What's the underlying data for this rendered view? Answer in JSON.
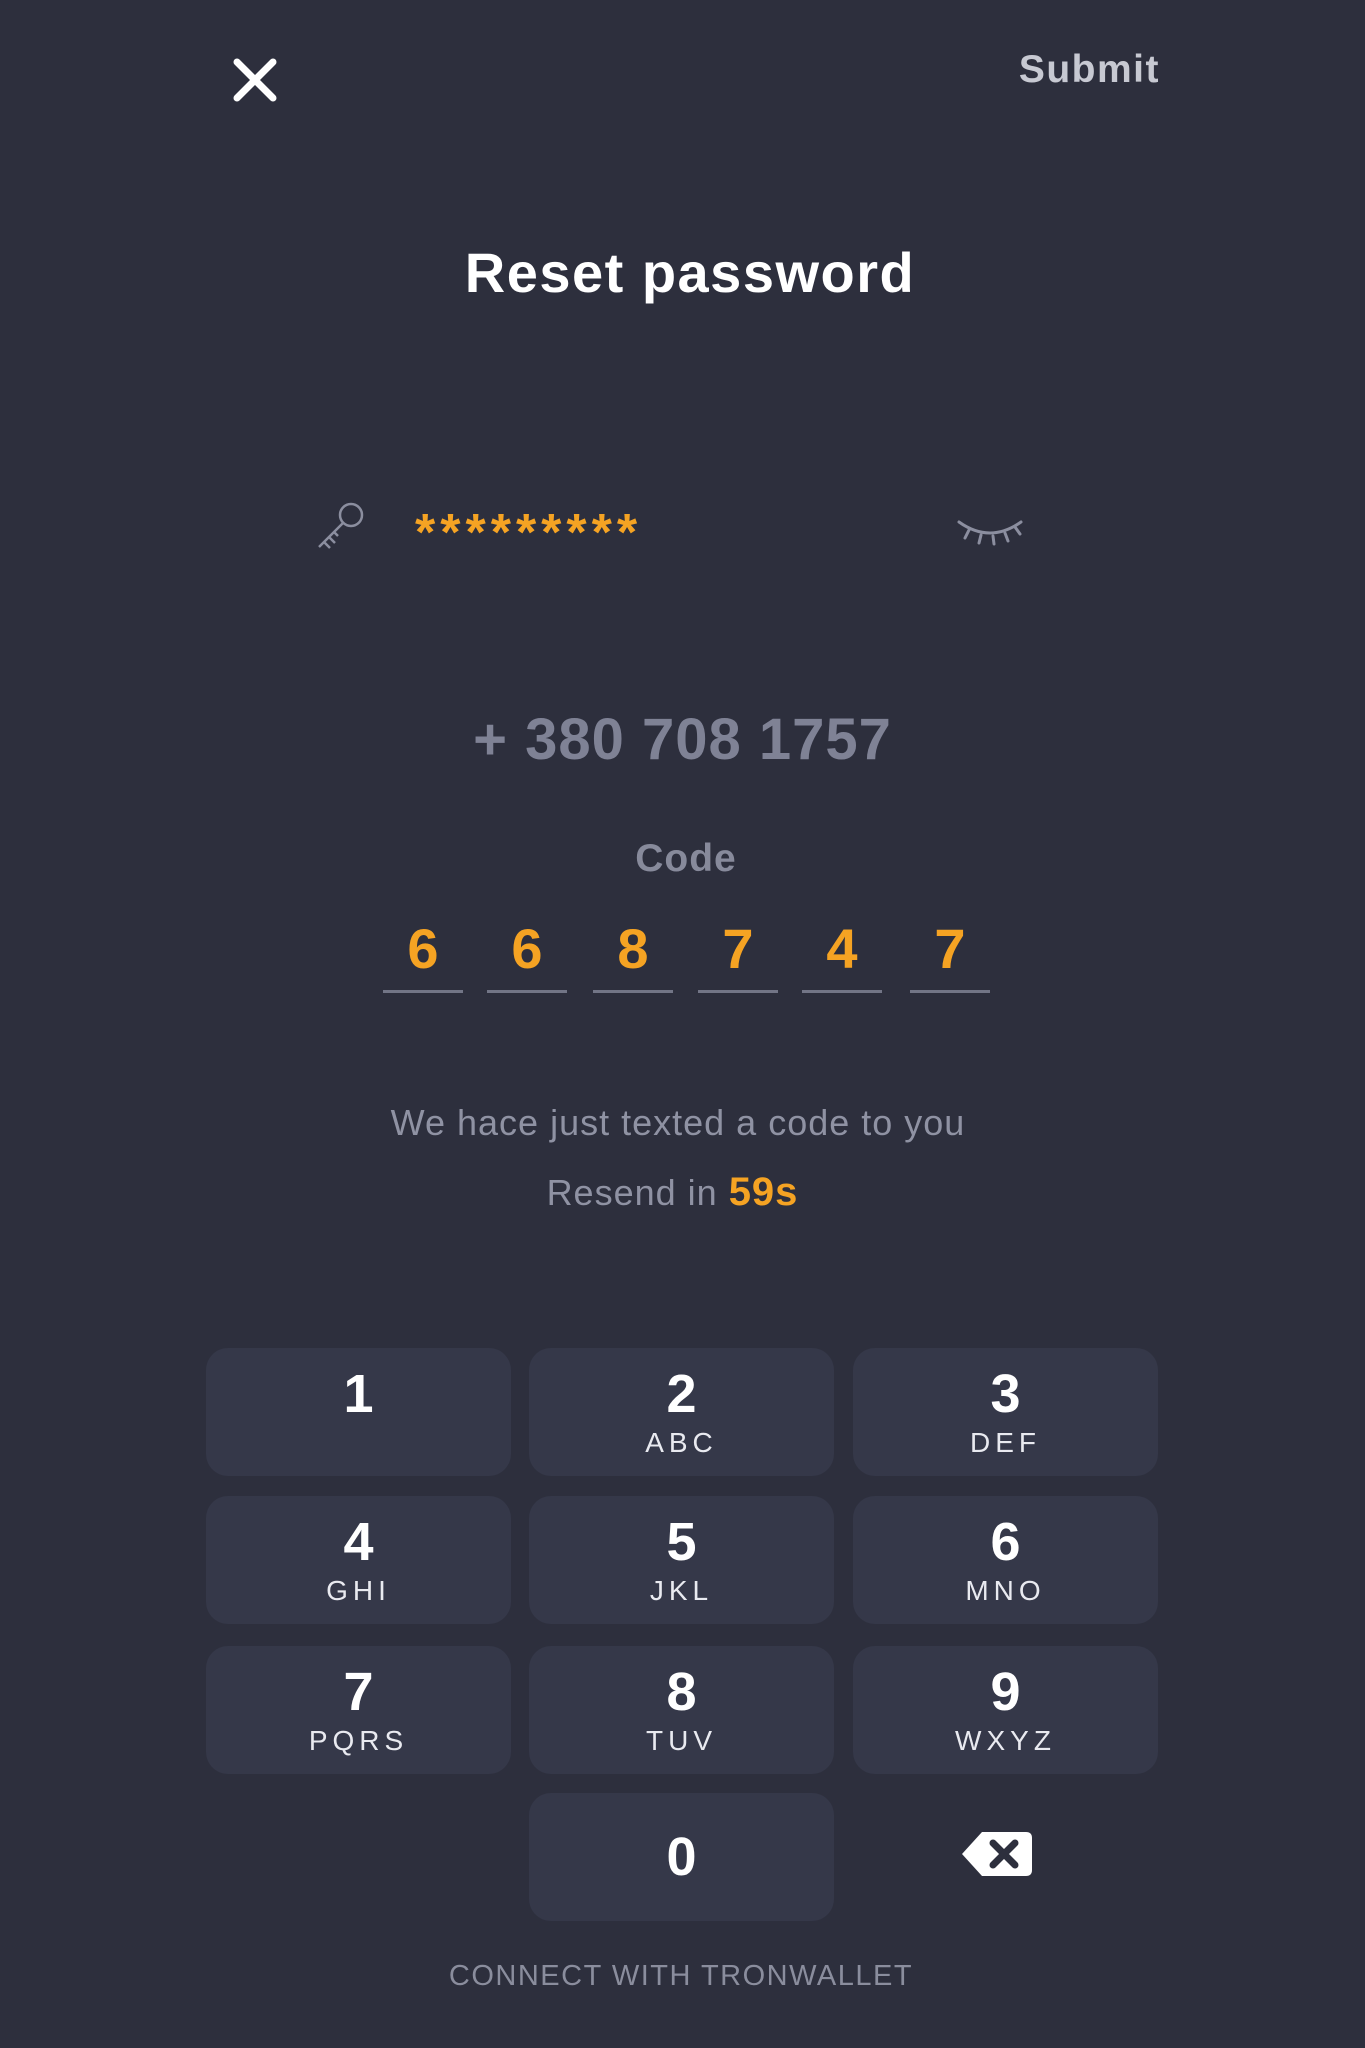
{
  "header": {
    "close_icon": "close-icon",
    "submit_label": "Submit"
  },
  "title": "Reset password",
  "password": {
    "icon": "key-icon",
    "value": "*********",
    "toggle_icon": "closed-eye-icon"
  },
  "phone": "+ 380 708 1757",
  "code": {
    "label": "Code",
    "digits": [
      "6",
      "6",
      "8",
      "7",
      "4",
      "7"
    ]
  },
  "info": {
    "message": "We hace just texted a code to you",
    "resend_label": "Resend in",
    "resend_timer": "59s"
  },
  "keypad": {
    "keys": [
      {
        "num": "1",
        "letters": ""
      },
      {
        "num": "2",
        "letters": "ABC"
      },
      {
        "num": "3",
        "letters": "DEF"
      },
      {
        "num": "4",
        "letters": "GHI"
      },
      {
        "num": "5",
        "letters": "JKL"
      },
      {
        "num": "6",
        "letters": "MNO"
      },
      {
        "num": "7",
        "letters": "PQRS"
      },
      {
        "num": "8",
        "letters": "TUV"
      },
      {
        "num": "9",
        "letters": "WXYZ"
      },
      {
        "num": "0",
        "letters": ""
      }
    ],
    "backspace_icon": "backspace-icon"
  },
  "footer": "CONNECT WITH TRONWALLET",
  "colors": {
    "background": "#2d2f3d",
    "accent": "#f5a323",
    "key_background": "#353849",
    "muted_text": "#8f92a3"
  }
}
